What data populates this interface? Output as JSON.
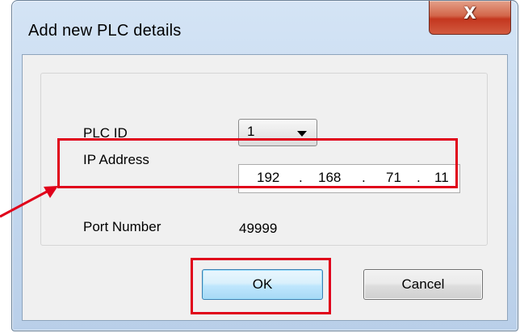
{
  "window": {
    "title": "Add new PLC details",
    "close_glyph": "X"
  },
  "form": {
    "plc_id": {
      "label": "PLC ID",
      "selected": "1"
    },
    "ip_address": {
      "label": "IP Address",
      "octets": [
        "192",
        "168",
        "71",
        "11"
      ],
      "separator": "."
    },
    "port": {
      "label": "Port Number",
      "value": "49999"
    }
  },
  "buttons": {
    "ok": "OK",
    "cancel": "Cancel"
  },
  "icons": {
    "close": "close-icon",
    "dropdown": "chevron-down-icon",
    "pointer": "arrow-pointer"
  },
  "colors": {
    "annotation": "#e0001a",
    "close_button": "#c4371f",
    "ok_border": "#3c7fb1"
  }
}
